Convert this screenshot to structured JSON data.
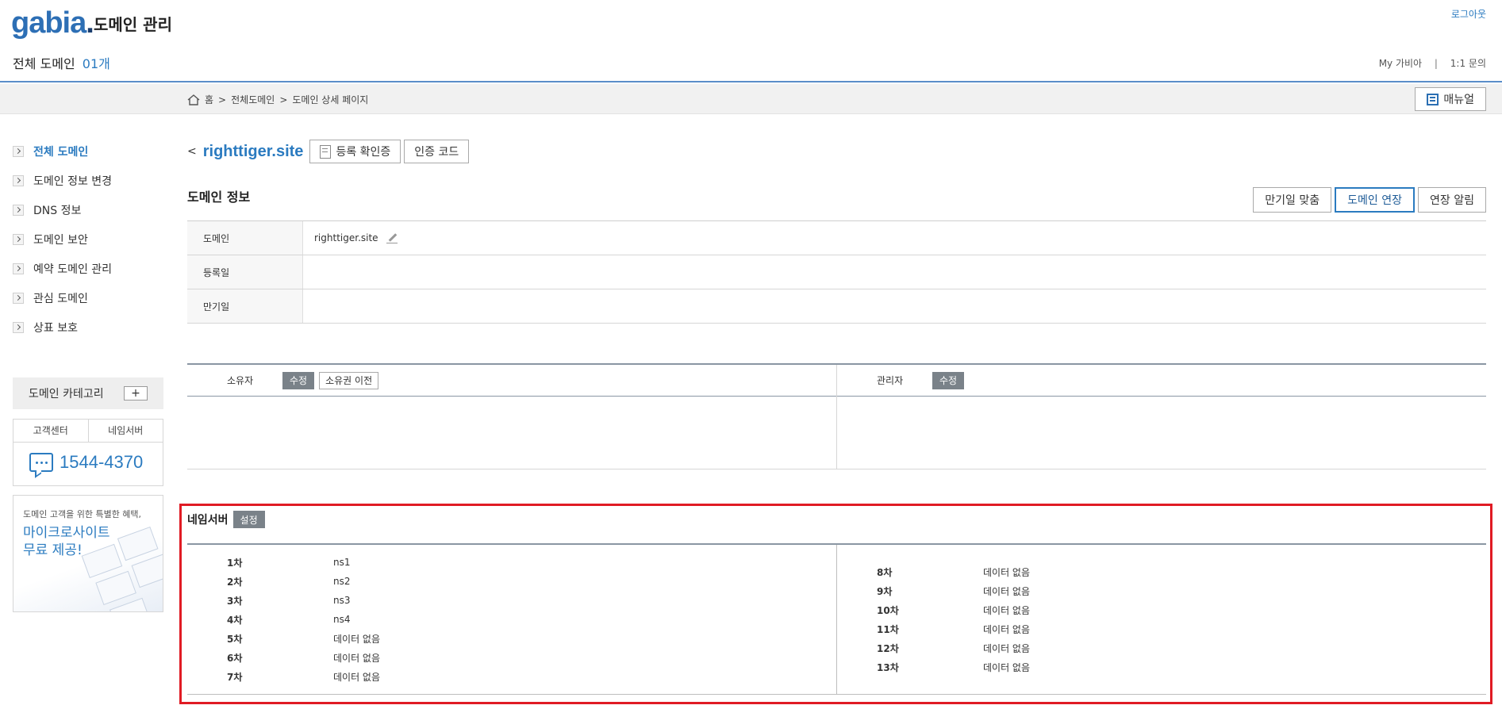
{
  "header": {
    "logo": "gabia",
    "app_title": "도메인 관리",
    "domain_count_label": "전체 도메인",
    "domain_count": "01개",
    "logout": "로그아웃",
    "my_gabia": "My 가비아",
    "separator": "|",
    "inquiry": "1:1 문의"
  },
  "breadcrumb": {
    "items": [
      "홈",
      ">",
      "전체도메인",
      ">",
      "도메인 상세 페이지"
    ],
    "manual_label": "매뉴얼"
  },
  "sidebar": {
    "items": [
      {
        "label": "전체 도메인",
        "active": true
      },
      {
        "label": "도메인 정보 변경",
        "active": false
      },
      {
        "label": "DNS 정보",
        "active": false
      },
      {
        "label": "도메인 보안",
        "active": false
      },
      {
        "label": "예약 도메인 관리",
        "active": false
      },
      {
        "label": "관심 도메인",
        "active": false
      },
      {
        "label": "상표 보호",
        "active": false
      }
    ],
    "category_label": "도메인 카테고리",
    "category_add": "+",
    "cs_tabs": [
      "고객센터",
      "네임서버"
    ],
    "phone": "1544-4370",
    "promo_sub": "도메인 고객을 위한 특별한 혜택,",
    "promo_main": "마이크로사이트 무료 제공!"
  },
  "domain": {
    "back": "<",
    "name": "righttiger.site",
    "cert_label": "등록 확인증",
    "auth_code_label": "인증 코드"
  },
  "info_section": {
    "title": "도메인 정보",
    "actions": [
      "만기일 맞춤",
      "도메인 연장",
      "연장 알림"
    ],
    "rows": [
      {
        "label": "도메인",
        "value": "righttiger.site"
      },
      {
        "label": "등록일",
        "value": ""
      },
      {
        "label": "만기일",
        "value": ""
      }
    ]
  },
  "contacts": {
    "owner_label": "소유자",
    "owner_edit": "수정",
    "owner_transfer": "소유권 이전",
    "admin_label": "관리자",
    "admin_edit": "수정"
  },
  "nameserver": {
    "title": "네임서버",
    "setting": "설정",
    "left": [
      {
        "key": "1차",
        "value": "ns1"
      },
      {
        "key": "2차",
        "value": "ns2"
      },
      {
        "key": "3차",
        "value": "ns3"
      },
      {
        "key": "4차",
        "value": "ns4"
      },
      {
        "key": "5차",
        "value": "데이터 없음"
      },
      {
        "key": "6차",
        "value": "데이터 없음"
      },
      {
        "key": "7차",
        "value": "데이터 없음"
      }
    ],
    "right": [
      {
        "key": "8차",
        "value": "데이터 없음"
      },
      {
        "key": "9차",
        "value": "데이터 없음"
      },
      {
        "key": "10차",
        "value": "데이터 없음"
      },
      {
        "key": "11차",
        "value": "데이터 없음"
      },
      {
        "key": "12차",
        "value": "데이터 없음"
      },
      {
        "key": "13차",
        "value": "데이터 없음"
      }
    ]
  },
  "colors": {
    "accent": "#2b7bc0",
    "highlight": "#e01b24",
    "gray_button": "#7a8289"
  }
}
